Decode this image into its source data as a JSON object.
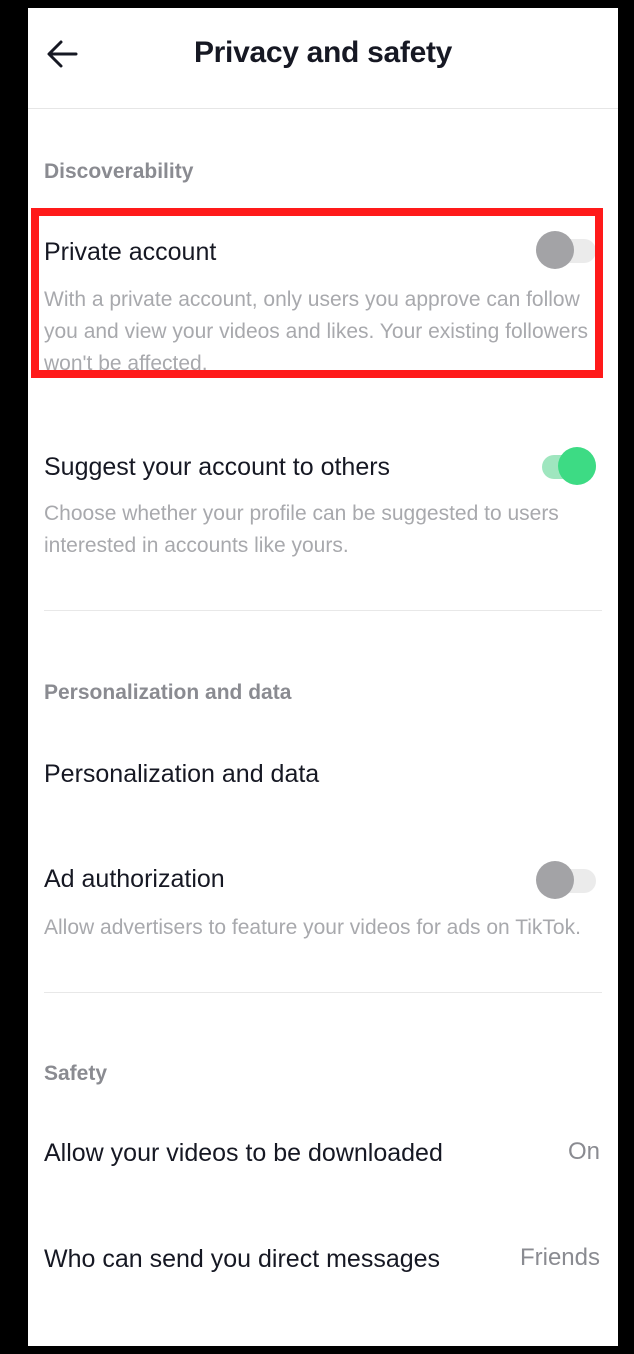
{
  "header": {
    "title": "Privacy and safety",
    "back_icon": "arrow-left-icon"
  },
  "sections": {
    "discoverability": {
      "label": "Discoverability",
      "private_account": {
        "title": "Private account",
        "desc": "With a private account, only users you approve can follow you and view your videos and likes. Your existing followers won't be affected.",
        "enabled": false
      },
      "suggest_account": {
        "title": "Suggest your account to others",
        "desc": "Choose whether your profile can be suggested to users interested in accounts like yours.",
        "enabled": true
      }
    },
    "personalization": {
      "label": "Personalization and data",
      "personalization_data": {
        "title": "Personalization and data"
      },
      "ad_authorization": {
        "title": "Ad authorization",
        "desc": "Allow advertisers to feature your videos for ads on TikTok.",
        "enabled": false
      }
    },
    "safety": {
      "label": "Safety",
      "downloads": {
        "title": "Allow your videos to be downloaded",
        "value": "On"
      },
      "direct_messages": {
        "title": "Who can send you direct messages",
        "value": "Friends"
      }
    }
  },
  "colors": {
    "highlight": "#ff1a1a",
    "toggle_on": "#3ddb84",
    "toggle_off": "#a3a3a6"
  }
}
